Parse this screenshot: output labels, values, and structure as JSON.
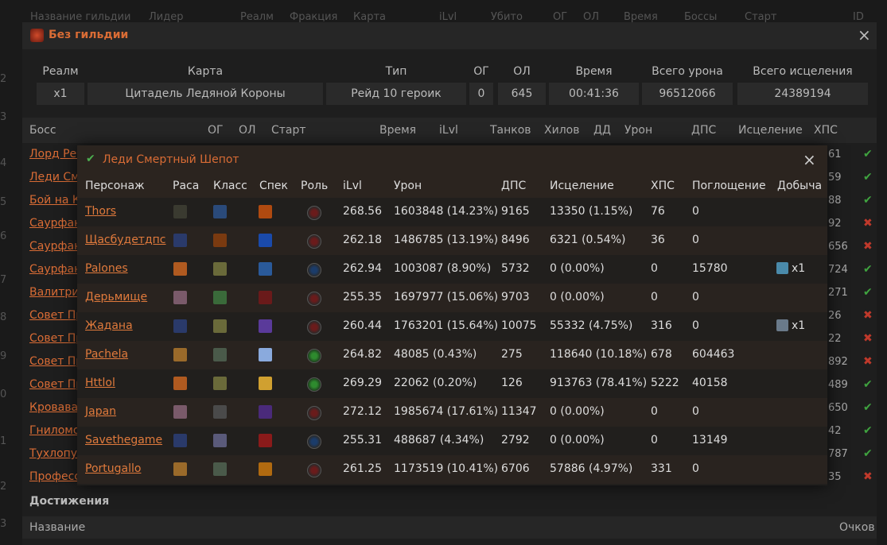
{
  "bg_header": [
    "Название гильдии",
    "Лидер",
    "Реалм",
    "Фракция",
    "Карта",
    "iLvl",
    "Убито",
    "ОГ",
    "ОЛ",
    "Время",
    "Боссы",
    "Старт",
    "ID"
  ],
  "bg_rownums": [
    "2",
    "3",
    "4",
    "5",
    "6",
    "7",
    "8",
    "9",
    "0",
    "1",
    "2",
    "3"
  ],
  "bg_right_values": [
    "61",
    "59",
    "88",
    "92",
    "656",
    "724",
    "271",
    "26",
    "22",
    "892",
    "489",
    "650",
    "42",
    "787",
    "35"
  ],
  "bg_marks": [
    "check",
    "check",
    "check",
    "cross",
    "cross",
    "check",
    "check",
    "cross",
    "cross",
    "cross",
    "check",
    "check",
    "check",
    "check",
    "cross"
  ],
  "guild_modal": {
    "title": "Без гильдии",
    "close": "×",
    "summary_headers": [
      "Реалм",
      "Карта",
      "Тип",
      "ОГ",
      "ОЛ",
      "Время",
      "Всего урона",
      "Всего исцеления"
    ],
    "summary_values": [
      "x1",
      "Цитадель Ледяной Короны",
      "Рейд 10 героик",
      "0",
      "645",
      "00:41:36",
      "96512066",
      "24389194"
    ],
    "boss_headers": [
      "Босс",
      "ОГ",
      "ОЛ",
      "Старт",
      "Время",
      "iLvl",
      "Танков",
      "Хилов",
      "ДД",
      "Урон",
      "ДПС",
      "Исцеление",
      "ХПС"
    ],
    "bosses": [
      "Лорд Ребр",
      "Леди См",
      "Бой на К",
      "Саурфан",
      "Саурфан",
      "Саурфан",
      "Валитри",
      "Совет Пр",
      "Совет Пр",
      "Совет Пр",
      "Совет Пр",
      "Кровава",
      "Гниломо",
      "Тухлопуз",
      "Професс"
    ],
    "achievements_title": "Достижения",
    "ach_headers": [
      "Название",
      "Очков"
    ]
  },
  "boss_modal": {
    "title": "Леди Смертный Шепот",
    "close": "×",
    "headers": [
      "Персонаж",
      "Раса",
      "Класс",
      "Спек",
      "Роль",
      "iLvl",
      "Урон",
      "ДПС",
      "Исцеление",
      "ХПС",
      "Поглощение",
      "Добыча"
    ],
    "rows": [
      {
        "name": "Thors",
        "race": "#3a3a30",
        "cls": "#2a4a7a",
        "spec": "#b04a10",
        "role": "dps",
        "ilvl": "268.56",
        "dmg": "1603848 (14.23%)",
        "dps": "9165",
        "heal": "13350 (1.15%)",
        "hps": "76",
        "absorb": "0",
        "loot": ""
      },
      {
        "name": "Щасбудетдпс",
        "race": "#2a3a6a",
        "cls": "#7a3a10",
        "spec": "#1a4aaa",
        "role": "dps",
        "ilvl": "262.18",
        "dmg": "1486785 (13.19%)",
        "dps": "8496",
        "heal": "6321 (0.54%)",
        "hps": "36",
        "absorb": "0",
        "loot": ""
      },
      {
        "name": "Palones",
        "race": "#b05a20",
        "cls": "#6a6a3a",
        "spec": "#2a5a9a",
        "role": "tank",
        "ilvl": "262.94",
        "dmg": "1003087 (8.90%)",
        "dps": "5732",
        "heal": "0 (0.00%)",
        "hps": "0",
        "absorb": "15780",
        "loot": "x1",
        "loot_color": "#4a8aaa"
      },
      {
        "name": "Дерьмище",
        "race": "#7a5a6a",
        "cls": "#3a6a3a",
        "spec": "#6a1a1a",
        "role": "dps",
        "ilvl": "255.35",
        "dmg": "1697977 (15.06%)",
        "dps": "9703",
        "heal": "0 (0.00%)",
        "hps": "0",
        "absorb": "0",
        "loot": ""
      },
      {
        "name": "Жадана",
        "race": "#2a3a6a",
        "cls": "#6a6a3a",
        "spec": "#5a3a9a",
        "role": "dps",
        "ilvl": "260.44",
        "dmg": "1763201 (15.64%)",
        "dps": "10075",
        "heal": "55332 (4.75%)",
        "hps": "316",
        "absorb": "0",
        "loot": "x1",
        "loot_color": "#6a7a8a"
      },
      {
        "name": "Pachela",
        "race": "#9a6a2a",
        "cls": "#4a5a4a",
        "spec": "#8aaadd",
        "role": "heal",
        "ilvl": "264.82",
        "dmg": "48085 (0.43%)",
        "dps": "275",
        "heal": "118640 (10.18%)",
        "hps": "678",
        "absorb": "604463",
        "loot": ""
      },
      {
        "name": "Httlol",
        "race": "#b05a20",
        "cls": "#6a6a3a",
        "spec": "#d0a030",
        "role": "heal",
        "ilvl": "269.29",
        "dmg": "22062 (0.20%)",
        "dps": "126",
        "heal": "913763 (78.41%)",
        "hps": "5222",
        "absorb": "40158",
        "loot": ""
      },
      {
        "name": "Japan",
        "race": "#7a5a6a",
        "cls": "#4a4a4a",
        "spec": "#4a2a7a",
        "role": "dps",
        "ilvl": "272.12",
        "dmg": "1985674 (17.61%)",
        "dps": "11347",
        "heal": "0 (0.00%)",
        "hps": "0",
        "absorb": "0",
        "loot": ""
      },
      {
        "name": "Savethegame",
        "race": "#2a3a6a",
        "cls": "#5a5a7a",
        "spec": "#8a1a1a",
        "role": "tank",
        "ilvl": "255.31",
        "dmg": "488687 (4.34%)",
        "dps": "2792",
        "heal": "0 (0.00%)",
        "hps": "0",
        "absorb": "13149",
        "loot": ""
      },
      {
        "name": "Portugallo",
        "race": "#9a6a2a",
        "cls": "#4a5a4a",
        "spec": "#b06a10",
        "role": "dps",
        "ilvl": "261.25",
        "dmg": "1173519 (10.41%)",
        "dps": "6706",
        "heal": "57886 (4.97%)",
        "hps": "331",
        "absorb": "0",
        "loot": ""
      }
    ]
  }
}
